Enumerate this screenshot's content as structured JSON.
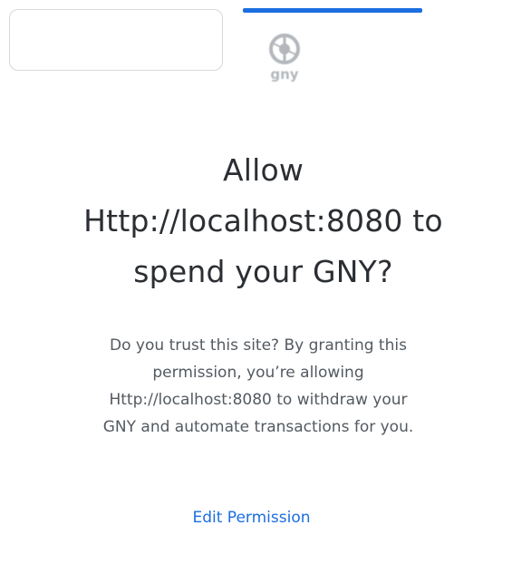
{
  "token": {
    "logo_icon": "gny-token-logo",
    "logo_text": "gny"
  },
  "title": {
    "line1": "Allow",
    "line2": "Http://localhost:8080 to",
    "line3": "spend your GNY?"
  },
  "description": {
    "line1": "Do you trust this site? By granting this",
    "line2": "permission, you’re allowing",
    "line3": "Http://localhost:8080 to withdraw your",
    "line4": "GNY and automate transactions for you."
  },
  "actions": {
    "edit_permission_label": "Edit Permission"
  },
  "colors": {
    "accent": "#1c6ee0",
    "title_text": "#2b2f33",
    "body_text": "#535a61",
    "border": "#d6d9dc"
  }
}
